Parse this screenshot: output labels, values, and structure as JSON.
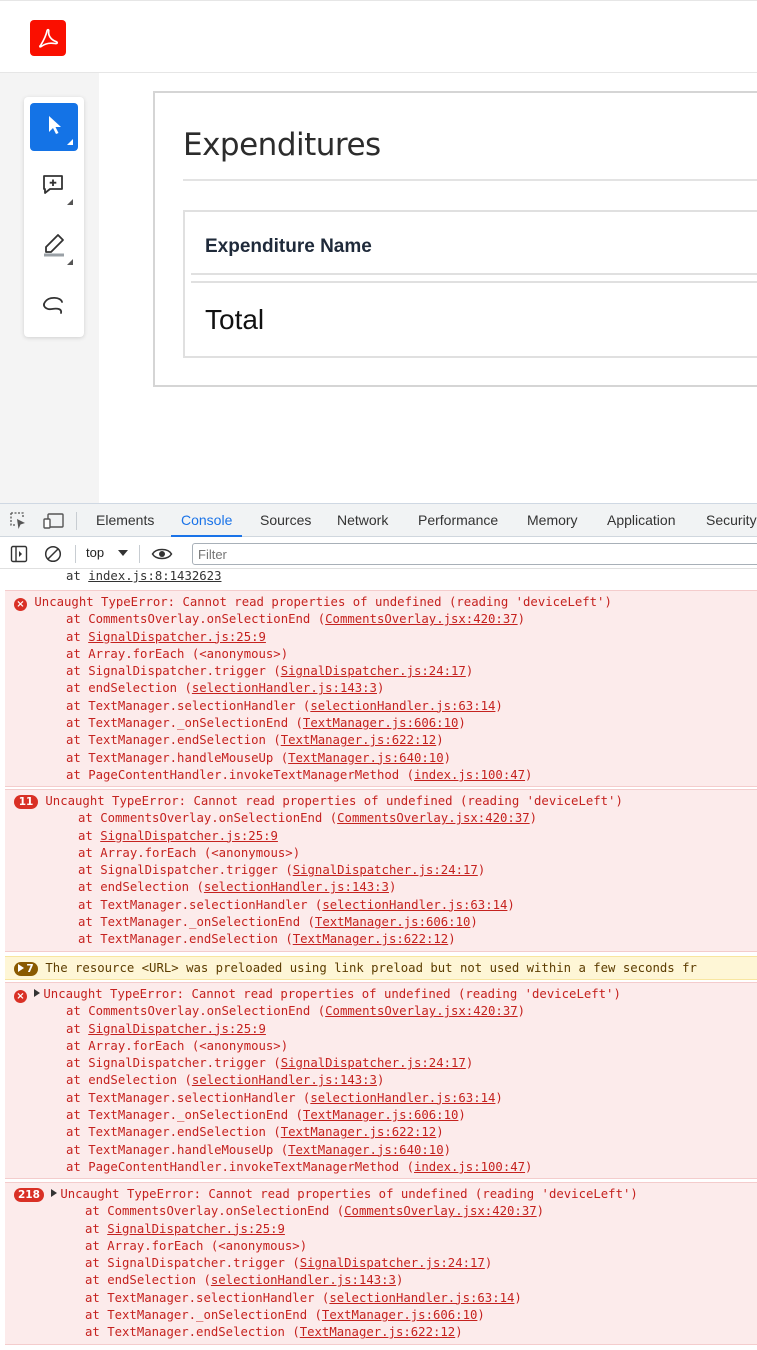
{
  "app": {
    "logo_icon": "acrobat-logo-icon",
    "tools": [
      {
        "name": "select-tool",
        "icon": "pointer-arrow-icon",
        "active": true
      },
      {
        "name": "comment-tool",
        "icon": "add-comment-icon",
        "active": false
      },
      {
        "name": "highlight-tool",
        "icon": "highlighter-pen-icon",
        "active": false
      },
      {
        "name": "draw-tool",
        "icon": "freehand-draw-icon",
        "active": false
      }
    ],
    "document": {
      "title": "Expenditures",
      "table_header": "Expenditure Name",
      "total_label": "Total"
    }
  },
  "devtools": {
    "tabs": [
      {
        "label": "Elements",
        "active": false
      },
      {
        "label": "Console",
        "active": true
      },
      {
        "label": "Sources",
        "active": false
      },
      {
        "label": "Network",
        "active": false
      },
      {
        "label": "Performance",
        "active": false
      },
      {
        "label": "Memory",
        "active": false
      },
      {
        "label": "Application",
        "active": false
      },
      {
        "label": "Security",
        "active": false
      }
    ],
    "context_label": "top",
    "filter_placeholder": "Filter",
    "colors": {
      "accent": "#1a73e8",
      "error": "#d93025",
      "error_bg": "#fcebeb",
      "warn_bg": "#fef6d6"
    }
  },
  "console": {
    "top_line": {
      "text": "at ",
      "link": "index.js:8:1432623"
    },
    "messages": [
      {
        "kind": "error",
        "count": "",
        "expandable": false,
        "text": "Uncaught TypeError: Cannot read properties of undefined (reading 'deviceLeft')",
        "frames": [
          {
            "fn": "CommentsOverlay.onSelectionEnd",
            "link": "CommentsOverlay.jsx:420:37"
          },
          {
            "fn": "",
            "link": "SignalDispatcher.js:25:9"
          },
          {
            "fn": "Array.forEach",
            "plain": "(<anonymous>)"
          },
          {
            "fn": "SignalDispatcher.trigger",
            "link": "SignalDispatcher.js:24:17"
          },
          {
            "fn": "endSelection",
            "link": "selectionHandler.js:143:3"
          },
          {
            "fn": "TextManager.selectionHandler",
            "link": "selectionHandler.js:63:14"
          },
          {
            "fn": "TextManager._onSelectionEnd",
            "link": "TextManager.js:606:10"
          },
          {
            "fn": "TextManager.endSelection",
            "link": "TextManager.js:622:12"
          },
          {
            "fn": "TextManager.handleMouseUp",
            "link": "TextManager.js:640:10"
          },
          {
            "fn": "PageContentHandler.invokeTextManagerMethod",
            "link": "index.js:100:47"
          }
        ]
      },
      {
        "kind": "error",
        "count": "11",
        "expandable": false,
        "text": "Uncaught TypeError: Cannot read properties of undefined (reading 'deviceLeft')",
        "frames": [
          {
            "fn": "CommentsOverlay.onSelectionEnd",
            "link": "CommentsOverlay.jsx:420:37"
          },
          {
            "fn": "",
            "link": "SignalDispatcher.js:25:9"
          },
          {
            "fn": "Array.forEach",
            "plain": "(<anonymous>)"
          },
          {
            "fn": "SignalDispatcher.trigger",
            "link": "SignalDispatcher.js:24:17"
          },
          {
            "fn": "endSelection",
            "link": "selectionHandler.js:143:3"
          },
          {
            "fn": "TextManager.selectionHandler",
            "link": "selectionHandler.js:63:14"
          },
          {
            "fn": "TextManager._onSelectionEnd",
            "link": "TextManager.js:606:10"
          },
          {
            "fn": "TextManager.endSelection",
            "link": "TextManager.js:622:12"
          }
        ]
      },
      {
        "kind": "warn",
        "count": "7",
        "expandable": true,
        "text": "The resource <URL> was preloaded using link preload but not used within a few seconds fr",
        "frames": []
      },
      {
        "kind": "error",
        "count": "",
        "expandable": true,
        "text": "Uncaught TypeError: Cannot read properties of undefined (reading 'deviceLeft')",
        "frames": [
          {
            "fn": "CommentsOverlay.onSelectionEnd",
            "link": "CommentsOverlay.jsx:420:37"
          },
          {
            "fn": "",
            "link": "SignalDispatcher.js:25:9"
          },
          {
            "fn": "Array.forEach",
            "plain": "(<anonymous>)"
          },
          {
            "fn": "SignalDispatcher.trigger",
            "link": "SignalDispatcher.js:24:17"
          },
          {
            "fn": "endSelection",
            "link": "selectionHandler.js:143:3"
          },
          {
            "fn": "TextManager.selectionHandler",
            "link": "selectionHandler.js:63:14"
          },
          {
            "fn": "TextManager._onSelectionEnd",
            "link": "TextManager.js:606:10"
          },
          {
            "fn": "TextManager.endSelection",
            "link": "TextManager.js:622:12"
          },
          {
            "fn": "TextManager.handleMouseUp",
            "link": "TextManager.js:640:10"
          },
          {
            "fn": "PageContentHandler.invokeTextManagerMethod",
            "link": "index.js:100:47"
          }
        ]
      },
      {
        "kind": "error",
        "count": "218",
        "expandable": true,
        "text": "Uncaught TypeError: Cannot read properties of undefined (reading 'deviceLeft')",
        "frames": [
          {
            "fn": "CommentsOverlay.onSelectionEnd",
            "link": "CommentsOverlay.jsx:420:37"
          },
          {
            "fn": "",
            "link": "SignalDispatcher.js:25:9"
          },
          {
            "fn": "Array.forEach",
            "plain": "(<anonymous>)"
          },
          {
            "fn": "SignalDispatcher.trigger",
            "link": "SignalDispatcher.js:24:17"
          },
          {
            "fn": "endSelection",
            "link": "selectionHandler.js:143:3"
          },
          {
            "fn": "TextManager.selectionHandler",
            "link": "selectionHandler.js:63:14"
          },
          {
            "fn": "TextManager._onSelectionEnd",
            "link": "TextManager.js:606:10"
          },
          {
            "fn": "TextManager.endSelection",
            "link": "TextManager.js:622:12"
          }
        ]
      }
    ]
  }
}
